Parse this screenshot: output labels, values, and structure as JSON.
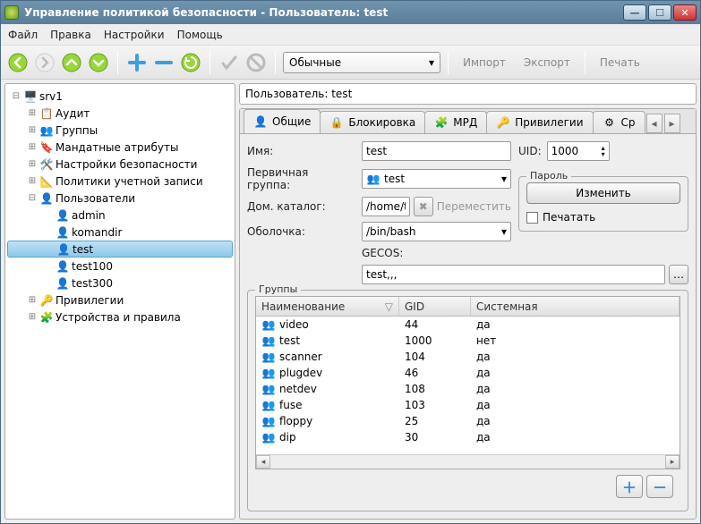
{
  "window": {
    "title": "Управление политикой безопасности - Пользователь: test"
  },
  "menu": {
    "file": "Файл",
    "edit": "Правка",
    "settings": "Настройки",
    "help": "Помощь"
  },
  "toolbar": {
    "combo_value": "Обычные",
    "import": "Импорт",
    "export": "Экспорт",
    "print": "Печать"
  },
  "tree": {
    "root": "srv1",
    "nodes": [
      {
        "label": "Аудит"
      },
      {
        "label": "Группы"
      },
      {
        "label": "Мандатные атрибуты"
      },
      {
        "label": "Настройки безопасности"
      },
      {
        "label": "Политики учетной записи"
      },
      {
        "label": "Пользователи",
        "expanded": true,
        "children": [
          {
            "label": "admin"
          },
          {
            "label": "komandir"
          },
          {
            "label": "test",
            "selected": true
          },
          {
            "label": "test100"
          },
          {
            "label": "test300"
          }
        ]
      },
      {
        "label": "Привилегии"
      },
      {
        "label": "Устройства и правила"
      }
    ]
  },
  "header": {
    "text": "Пользователь: test"
  },
  "tabs": {
    "items": [
      {
        "label": "Общие",
        "active": true
      },
      {
        "label": "Блокировка"
      },
      {
        "label": "МРД"
      },
      {
        "label": "Привилегии"
      },
      {
        "label": "Ср"
      }
    ]
  },
  "form": {
    "name_label": "Имя:",
    "name_value": "test",
    "uid_label": "UID:",
    "uid_value": "1000",
    "primary_group_label": "Первичная группа:",
    "primary_group_value": "test",
    "home_label": "Дом. каталог:",
    "home_value": "/home/test",
    "move_label": "Переместить",
    "shell_label": "Оболочка:",
    "shell_value": "/bin/bash",
    "gecos_label": "GECOS:",
    "gecos_value": "test,,,",
    "password_legend": "Пароль",
    "change_btn": "Изменить",
    "print_chk": "Печатать"
  },
  "groups": {
    "legend": "Группы",
    "columns": {
      "name": "Наименование",
      "gid": "GID",
      "system": "Системная"
    },
    "rows": [
      {
        "name": "video",
        "gid": "44",
        "system": "да"
      },
      {
        "name": "test",
        "gid": "1000",
        "system": "нет"
      },
      {
        "name": "scanner",
        "gid": "104",
        "system": "да"
      },
      {
        "name": "plugdev",
        "gid": "46",
        "system": "да"
      },
      {
        "name": "netdev",
        "gid": "108",
        "system": "да"
      },
      {
        "name": "fuse",
        "gid": "103",
        "system": "да"
      },
      {
        "name": "floppy",
        "gid": "25",
        "system": "да"
      },
      {
        "name": "dip",
        "gid": "30",
        "system": "да"
      }
    ]
  }
}
